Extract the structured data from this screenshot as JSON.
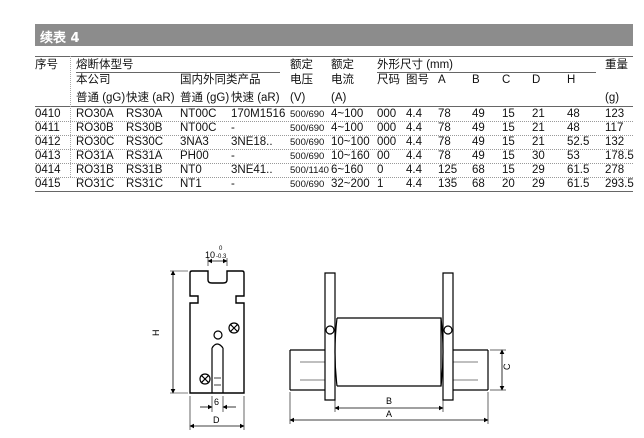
{
  "title": "续表 4",
  "headers": {
    "no": "序号",
    "model": "熔断体型号",
    "company": "本公司",
    "domestic": "国内外同类产品",
    "normal": "普通 (gG)",
    "fast": "快速 (aR)",
    "rated1": "额定",
    "voltage": "电压",
    "voltage_unit": "(V)",
    "rated2": "额定",
    "current": "电流",
    "current_unit": "(A)",
    "dims": "外形尺寸 (mm)",
    "size_code": "尺码",
    "fig_no": "图号",
    "A": "A",
    "B": "B",
    "C": "C",
    "D": "D",
    "H": "H",
    "weight": "重量",
    "weight_unit": "(g)"
  },
  "rows": [
    {
      "no": "0410",
      "cg": "RO30A",
      "ca": "RS30A",
      "dg": "NT00C",
      "da": "170M1516",
      "v": "500/690",
      "i": "4~100",
      "code": "000",
      "fig": "4.4",
      "A": "78",
      "B": "49",
      "C": "15",
      "D": "21",
      "H": "48",
      "w": "123"
    },
    {
      "no": "0411",
      "cg": "RO30B",
      "ca": "RS30B",
      "dg": "NT00C",
      "da": "-",
      "v": "500/690",
      "i": "4~100",
      "code": "000",
      "fig": "4.4",
      "A": "78",
      "B": "49",
      "C": "15",
      "D": "21",
      "H": "48",
      "w": "117"
    },
    {
      "no": "0412",
      "cg": "RO30C",
      "ca": "RS30C",
      "dg": "3NA3",
      "da": "3NE18..",
      "v": "500/690",
      "i": "10~100",
      "code": "000",
      "fig": "4.4",
      "A": "78",
      "B": "49",
      "C": "15",
      "D": "21",
      "H": "52.5",
      "w": "132"
    },
    {
      "no": "0413",
      "cg": "RO31A",
      "ca": "RS31A",
      "dg": "PH00",
      "da": "-",
      "v": "500/690",
      "i": "10~160",
      "code": "00",
      "fig": "4.4",
      "A": "78",
      "B": "49",
      "C": "15",
      "D": "30",
      "H": "53",
      "w": "178.5"
    },
    {
      "no": "0414",
      "cg": "RO31B",
      "ca": "RS31B",
      "dg": "NT0",
      "da": "3NE41..",
      "v": "500/1140",
      "i": "6~160",
      "code": "0",
      "fig": "4.4",
      "A": "125",
      "B": "68",
      "C": "15",
      "D": "29",
      "H": "61.5",
      "w": "278"
    },
    {
      "no": "0415",
      "cg": "RO31C",
      "ca": "RS31C",
      "dg": "NT1",
      "da": "-",
      "v": "500/690",
      "i": "32~200",
      "code": "1",
      "fig": "4.4",
      "A": "135",
      "B": "68",
      "C": "20",
      "D": "29",
      "H": "61.5",
      "w": "293.5"
    }
  ],
  "drawing_labels": {
    "slot": "10",
    "slot_tol": "-0.3",
    "tol_upper": "0",
    "H": "H",
    "six": "6",
    "D": "D",
    "B": "B",
    "A": "A",
    "C": "C"
  }
}
